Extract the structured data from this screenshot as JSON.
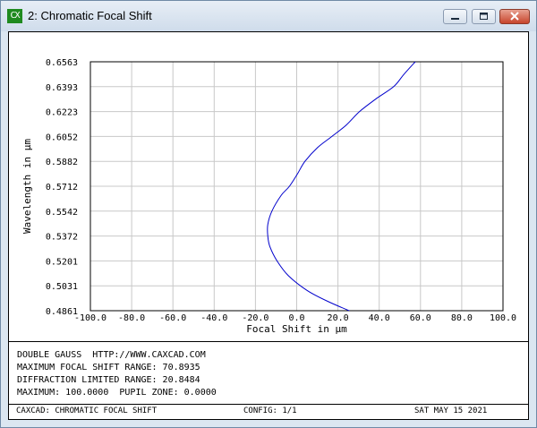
{
  "window": {
    "icon_text": "CX",
    "title": "2: Chromatic Focal Shift",
    "icons": {
      "app": "caxcad-icon",
      "minimize": "minimize-icon",
      "maximize": "maximize-icon",
      "close": "close-icon"
    },
    "colors": {
      "close_button": "#c7452c",
      "icon_green": "#1f8a1f"
    }
  },
  "chart_data": {
    "type": "line",
    "xlabel": "Focal Shift in µm",
    "ylabel": "Wavelength in µm",
    "xlim": [
      -100.0,
      100.0
    ],
    "ylim": [
      0.4861,
      0.6563
    ],
    "x_ticks": [
      "-100.0",
      "-80.0",
      "-60.0",
      "-40.0",
      "-20.0",
      "0.0",
      "20.0",
      "40.0",
      "60.0",
      "80.0",
      "100.0"
    ],
    "y_ticks": [
      "0.6563",
      "0.6393",
      "0.6223",
      "0.6052",
      "0.5882",
      "0.5712",
      "0.5542",
      "0.5372",
      "0.5201",
      "0.5031",
      "0.4861"
    ],
    "grid": true,
    "series": [
      {
        "color": "#0000cc",
        "points": [
          [
            25.5,
            0.4861
          ],
          [
            15.0,
            0.4925
          ],
          [
            5.0,
            0.5
          ],
          [
            -4.0,
            0.51
          ],
          [
            -9.5,
            0.5201
          ],
          [
            -13.0,
            0.53
          ],
          [
            -14.0,
            0.5372
          ],
          [
            -14.0,
            0.545
          ],
          [
            -12.0,
            0.5542
          ],
          [
            -7.5,
            0.565
          ],
          [
            -3.5,
            0.5712
          ],
          [
            0.5,
            0.58
          ],
          [
            4.0,
            0.5882
          ],
          [
            10.0,
            0.5975
          ],
          [
            17.0,
            0.6052
          ],
          [
            24.0,
            0.613
          ],
          [
            30.5,
            0.6223
          ],
          [
            38.5,
            0.631
          ],
          [
            47.0,
            0.6393
          ],
          [
            52.0,
            0.6478
          ],
          [
            57.5,
            0.6563
          ]
        ]
      }
    ]
  },
  "info": {
    "line1": "DOUBLE GAUSS  HTTP://WWW.CAXCAD.COM",
    "line2": "MAXIMUM FOCAL SHIFT RANGE: 70.8935",
    "line3": "DIFFRACTION LIMITED RANGE: 20.8484",
    "line4": "MAXIMUM: 100.0000  PUPIL ZONE: 0.0000"
  },
  "footer": {
    "left": "CAXCAD: CHROMATIC FOCAL SHIFT",
    "center": "CONFIG: 1/1",
    "right": "SAT MAY 15 2021"
  }
}
